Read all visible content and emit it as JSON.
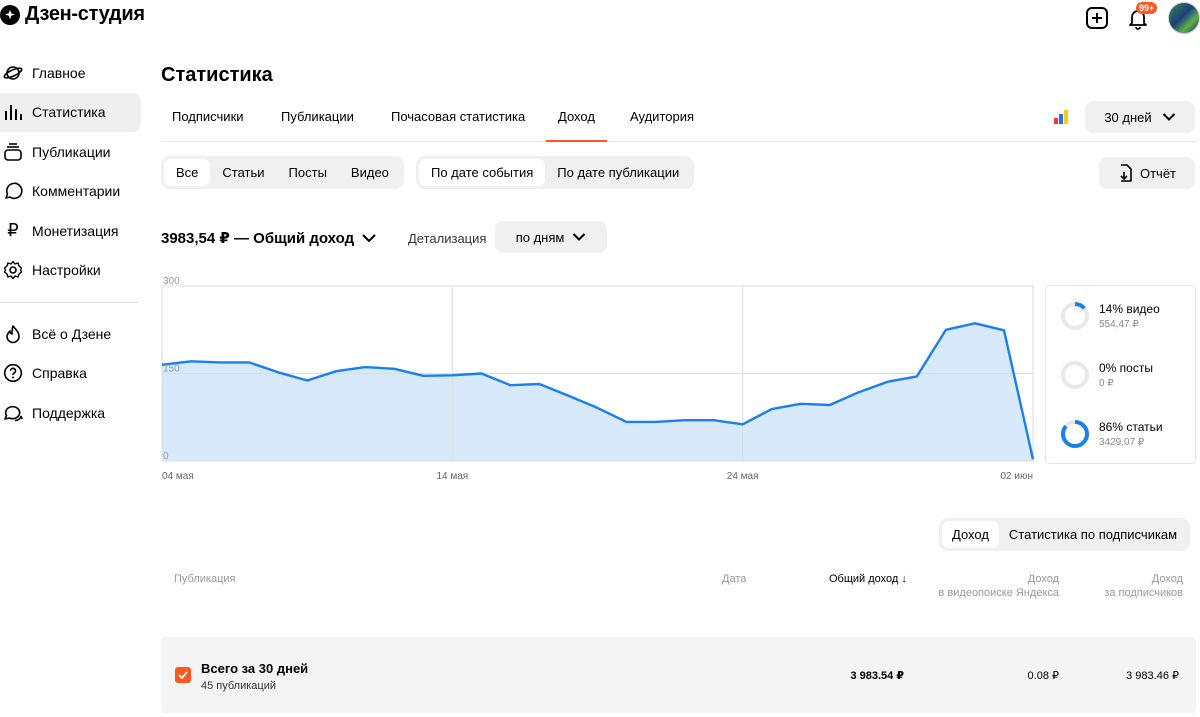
{
  "header": {
    "app_title": "Дзен-студия",
    "notifications_badge": "99+"
  },
  "sidebar": {
    "items": [
      {
        "label": "Главное",
        "icon": "planet-icon"
      },
      {
        "label": "Статистика",
        "icon": "bar-chart-icon",
        "active": true
      },
      {
        "label": "Публикации",
        "icon": "stack-icon"
      },
      {
        "label": "Комментарии",
        "icon": "comment-icon"
      },
      {
        "label": "Монетизация",
        "icon": "ruble-icon"
      },
      {
        "label": "Настройки",
        "icon": "gear-icon"
      }
    ],
    "bottom_items": [
      {
        "label": "Всё о Дзене",
        "icon": "flame-icon"
      },
      {
        "label": "Справка",
        "icon": "help-icon"
      },
      {
        "label": "Поддержка",
        "icon": "support-chat-icon"
      }
    ]
  },
  "page": {
    "title": "Статистика"
  },
  "tabs": {
    "items": [
      "Подписчики",
      "Публикации",
      "Почасовая статистика",
      "Доход",
      "Аудитория"
    ],
    "active": "Доход"
  },
  "period": {
    "label": "30 дней"
  },
  "filters": {
    "content_types": [
      "Все",
      "Статьи",
      "Посты",
      "Видео"
    ],
    "content_active": "Все",
    "date_modes": [
      "По дате события",
      "По дате публикации"
    ],
    "date_active": "По дате события",
    "report_label": "Отчёт"
  },
  "summary": {
    "total": "3983,54 ₽ — Общий доход",
    "detail_label": "Детализация",
    "detail_value": "по дням"
  },
  "chart_data": {
    "type": "area",
    "x_tick_labels": [
      "04 мая",
      "14 мая",
      "24 мая",
      "02 июн"
    ],
    "y_tick_labels": [
      "300",
      "150",
      "0"
    ],
    "ylim": [
      0,
      300
    ],
    "x": [
      "04 мая",
      "05 мая",
      "06 мая",
      "07 мая",
      "08 мая",
      "09 мая",
      "10 мая",
      "11 мая",
      "12 мая",
      "13 мая",
      "14 мая",
      "15 мая",
      "16 мая",
      "17 мая",
      "18 мая",
      "19 мая",
      "20 мая",
      "21 мая",
      "22 мая",
      "23 мая",
      "24 мая",
      "25 мая",
      "26 мая",
      "27 мая",
      "28 мая",
      "29 мая",
      "30 мая",
      "31 мая",
      "01 июн",
      "02 июн"
    ],
    "values": [
      165,
      171,
      169,
      169,
      152,
      138,
      154,
      161,
      158,
      146,
      147,
      150,
      130,
      132,
      112,
      91,
      67,
      67,
      70,
      70,
      63,
      89,
      98,
      96,
      118,
      136,
      145,
      225,
      236,
      224,
      3
    ],
    "color": "#1a7ff0",
    "fill": "#d8e9fb",
    "grid": true
  },
  "breakdown": [
    {
      "pct": "14% видео",
      "amount": "554,47 ₽",
      "fraction": 0.14
    },
    {
      "pct": "0% посты",
      "amount": "0 ₽",
      "fraction": 0.0
    },
    {
      "pct": "86% статьи",
      "amount": "3429,07 ₽",
      "fraction": 0.86
    }
  ],
  "table_mode": {
    "options": [
      "Доход",
      "Статистика по подписчикам"
    ],
    "active": "Доход"
  },
  "table": {
    "headers": {
      "publication": "Публикация",
      "date": "Дата",
      "total": "Общий доход ↓",
      "video_search_1": "Доход",
      "video_search_2": "в видеопоиске Яндекса",
      "subs_1": "Доход",
      "subs_2": "за подписчиков"
    },
    "total_row": {
      "title": "Всего за 30 дней",
      "subtitle": "45 публикаций",
      "total": "3 983.54 ₽",
      "video_search": "0.08 ₽",
      "subs": "3 983.46 ₽"
    }
  }
}
